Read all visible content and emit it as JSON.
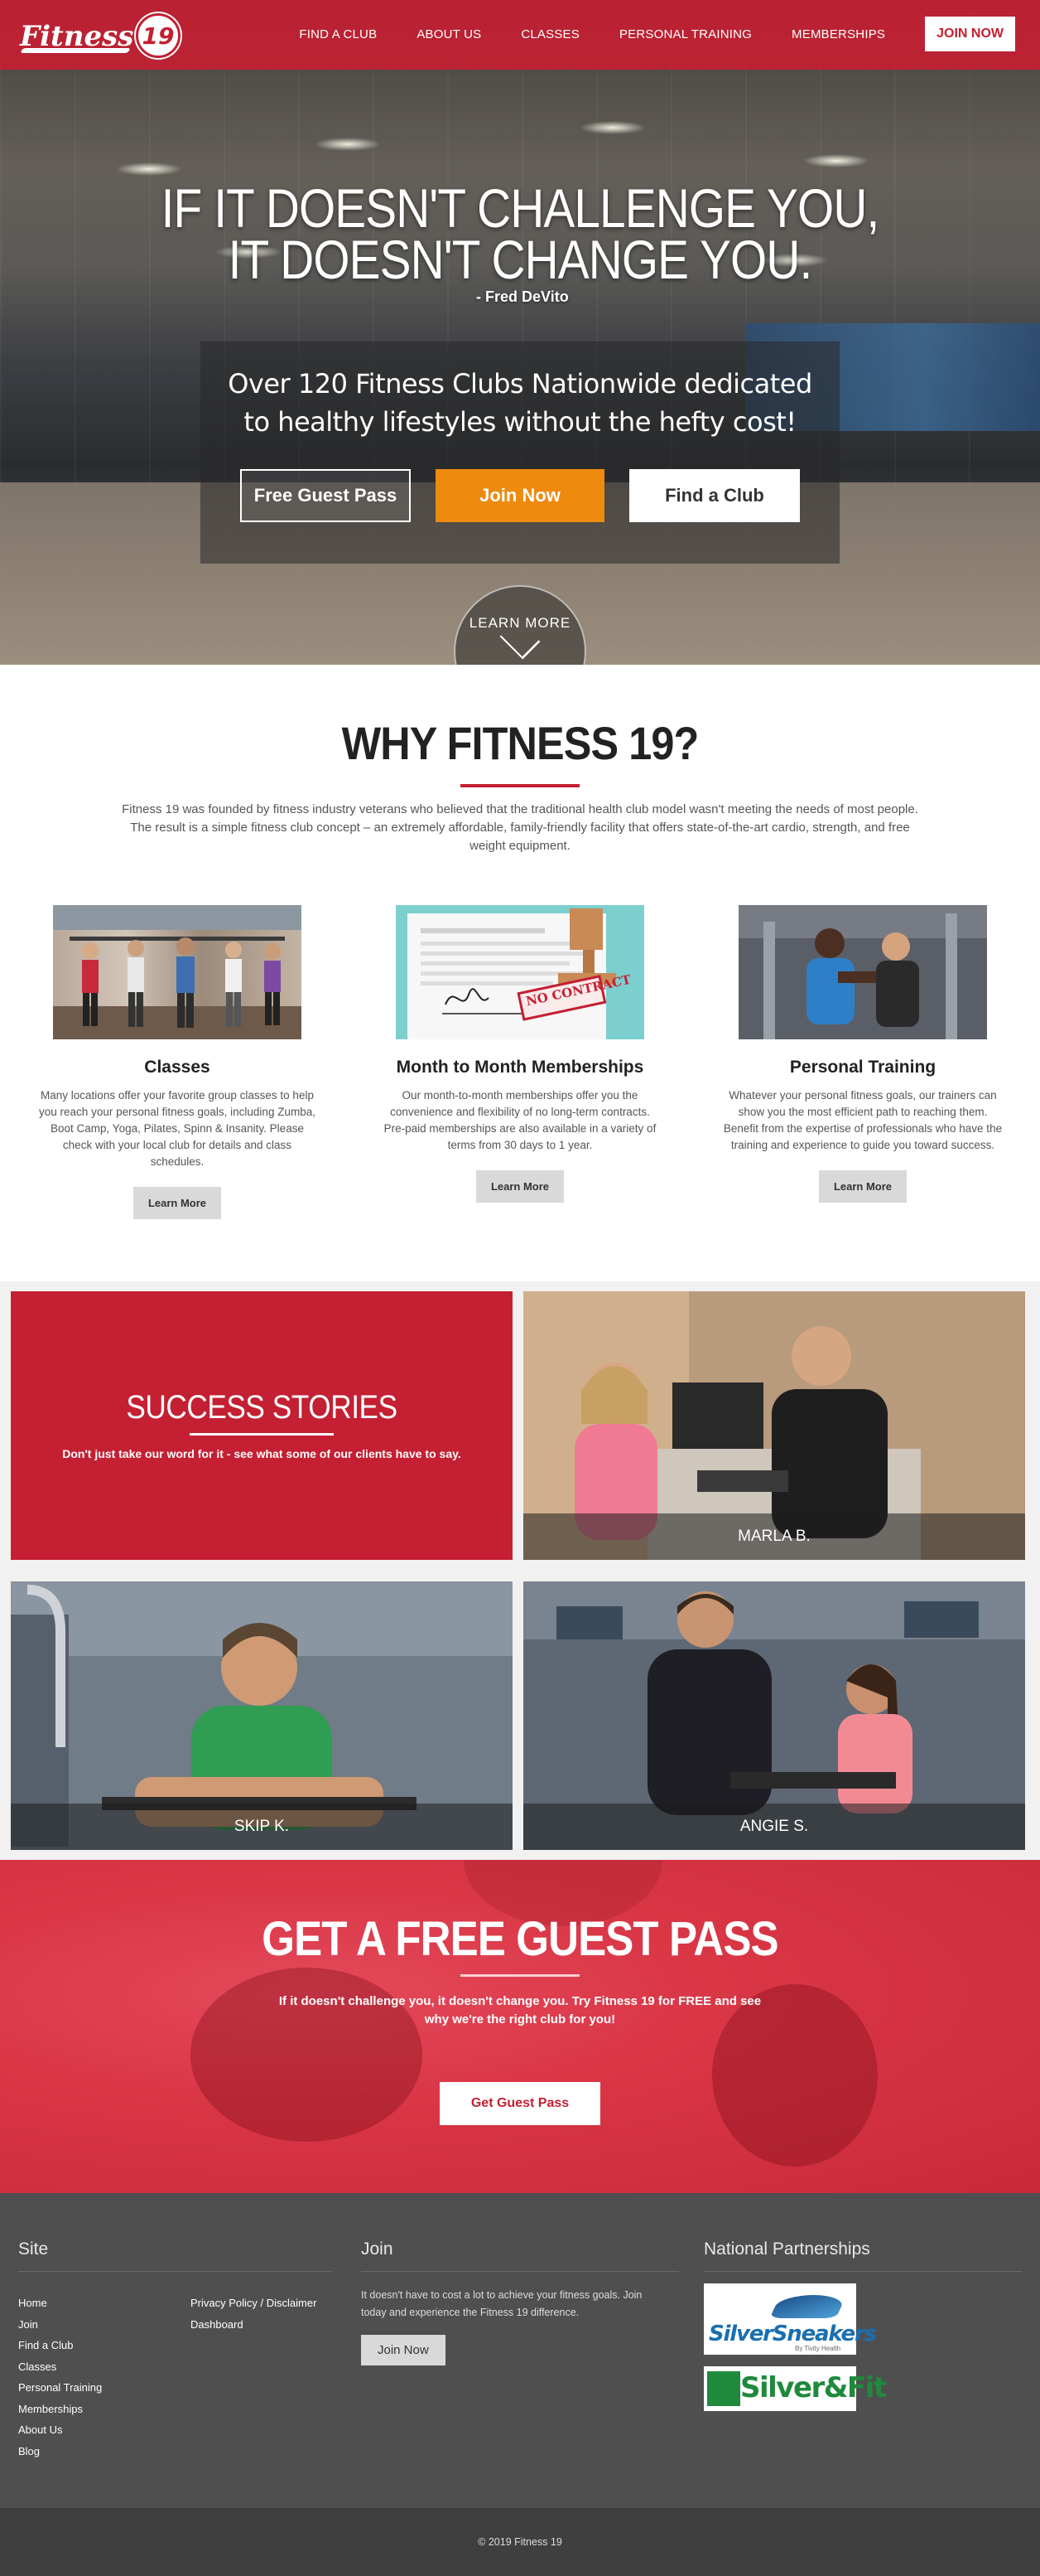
{
  "header": {
    "logo_text": "Fitness",
    "logo_number": "19",
    "nav": [
      "FIND A CLUB",
      "ABOUT US",
      "CLASSES",
      "PERSONAL TRAINING",
      "MEMBERSHIPS"
    ],
    "join_label": "JOIN NOW",
    "brand_color": "#c41f32"
  },
  "hero": {
    "quote_lines": [
      "IF IT DOESN'T CHALLENGE YOU,",
      "IT DOESN'T CHANGE YOU."
    ],
    "author": "- Fred DeVito",
    "tagline_lines": [
      "Over 120 Fitness Clubs Nationwide dedicated",
      "to healthy lifestyles without the hefty cost!"
    ],
    "buttons": {
      "guest": "Free Guest Pass",
      "join": "Join Now",
      "find": "Find a Club"
    },
    "learn_more": "LEARN MORE",
    "join_button_color": "#ee8a0d"
  },
  "why": {
    "title": "WHY FITNESS 19?",
    "intro": "Fitness 19 was founded by fitness industry veterans who believed that the traditional health club model wasn't meeting the needs of most people. The result is a simple fitness club concept – an extremely affordable, family-friendly facility that offers state-of-the-art cardio, strength, and free weight equipment.",
    "features": [
      {
        "title": "Classes",
        "text": "Many locations offer your favorite group classes to help you reach your personal fitness goals, including Zumba, Boot Camp, Yoga, Pilates, Spinn & Insanity. Please check with your local club for details and class schedules.",
        "button": "Learn More"
      },
      {
        "title": "Month to Month Memberships",
        "text": "Our month-to-month memberships offer you the convenience and flexibility of no long-term contracts. Pre-paid memberships are also available in a variety of terms from 30 days to 1 year.",
        "button": "Learn More",
        "stamp": "NO CONTRACT"
      },
      {
        "title": "Personal Training",
        "text": "Whatever your personal fitness goals, our trainers can show you the most efficient path to reaching them. Benefit from the expertise of professionals who have the training and experience to guide you toward success.",
        "button": "Learn More"
      }
    ]
  },
  "stories": {
    "title": "SUCCESS STORIES",
    "subtitle": "Don't just take our word for it - see what some of our clients have to say.",
    "people": [
      "MARLA B.",
      "SKIP K.",
      "ANGIE S."
    ]
  },
  "guest_pass": {
    "title": "GET A FREE GUEST PASS",
    "text": "If it doesn't challenge you, it doesn't change you. Try Fitness 19 for FREE and see why we're the right club for you!",
    "button": "Get Guest Pass"
  },
  "footer": {
    "site_heading": "Site",
    "site_links_a": [
      "Home",
      "Join",
      "Find a Club",
      "Classes",
      "Personal Training",
      "Memberships",
      "About Us",
      "Blog"
    ],
    "site_links_b": [
      "Privacy Policy / Disclaimer",
      "Dashboard"
    ],
    "join_heading": "Join",
    "join_text": "It doesn't have to cost a lot to achieve your fitness goals. Join today and experience the Fitness 19 difference.",
    "join_button": "Join Now",
    "partners_heading": "National Partnerships",
    "partner_silversneakers": "SilverSneakers",
    "partner_silversneakers_by": "By Tivity Health",
    "partner_silverfit": "Silver&Fit",
    "copyright": "© 2019 Fitness 19"
  }
}
